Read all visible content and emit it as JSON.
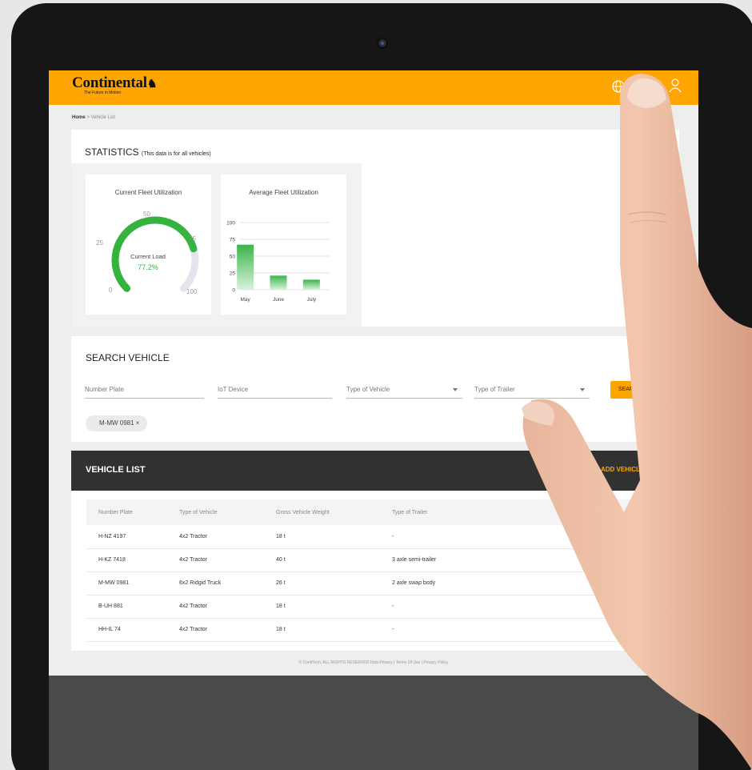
{
  "header": {
    "brand": "Continental",
    "tagline": "The Future in Motion"
  },
  "breadcrumb": {
    "home": "Home",
    "separator": ">",
    "current": "Vehicle List"
  },
  "statistics": {
    "title": "STATISTICS",
    "subtitle": "(This data is for all vehicles)",
    "current": {
      "title": "Current Fleet Utilization",
      "center_label": "Current Load",
      "value_text": "77.2%",
      "value": 77.2,
      "ticks": [
        "0",
        "25",
        "50",
        "75",
        "100"
      ]
    },
    "average": {
      "title": "Average Fleet Utilization",
      "y_ticks": [
        "100",
        "75",
        "50",
        "25",
        "0"
      ],
      "bars": [
        {
          "label": "May",
          "value": 67
        },
        {
          "label": "June",
          "value": 21
        },
        {
          "label": "July",
          "value": 15
        }
      ]
    }
  },
  "search": {
    "title": "SEARCH VEHICLE",
    "number_plate_placeholder": "Number Plate",
    "iot_placeholder": "IoT Device",
    "vehicle_type_placeholder": "Type of Vehicle",
    "trailer_type_placeholder": "Type of Trailer",
    "button": "SEARCH",
    "chip": "M-MW 0981",
    "chip_remove": "×"
  },
  "vehicle_list": {
    "title": "VEHICLE LIST",
    "add_button": "ADD VEHICLE",
    "columns": [
      "Number Plate",
      "Type of Vehicle",
      "Gross Vehicle Weight",
      "Type of Trailer"
    ],
    "rows": [
      [
        "H-NZ 4197",
        "4x2 Tractor",
        "18 t",
        "-"
      ],
      [
        "H-KZ 7418",
        "4x2 Tractor",
        "40 t",
        "3 axle semi-trailer"
      ],
      [
        "M-MW 0981",
        "6x2 Ridgid Truck",
        "26 t",
        "2 axle swap body"
      ],
      [
        "B-UH 881",
        "4x2 Tractor",
        "18 t",
        "-"
      ],
      [
        "HH-IL 74",
        "4x2 Tractor",
        "18 t",
        "-"
      ]
    ]
  },
  "footer": {
    "text": "© ContiTech, ALL RIGHTS RESERVED Data Privacy | Terms Of Use | Privacy Policy"
  },
  "colors": {
    "brand": "#ffa500",
    "success": "#3cb34a",
    "dark": "#313131"
  }
}
